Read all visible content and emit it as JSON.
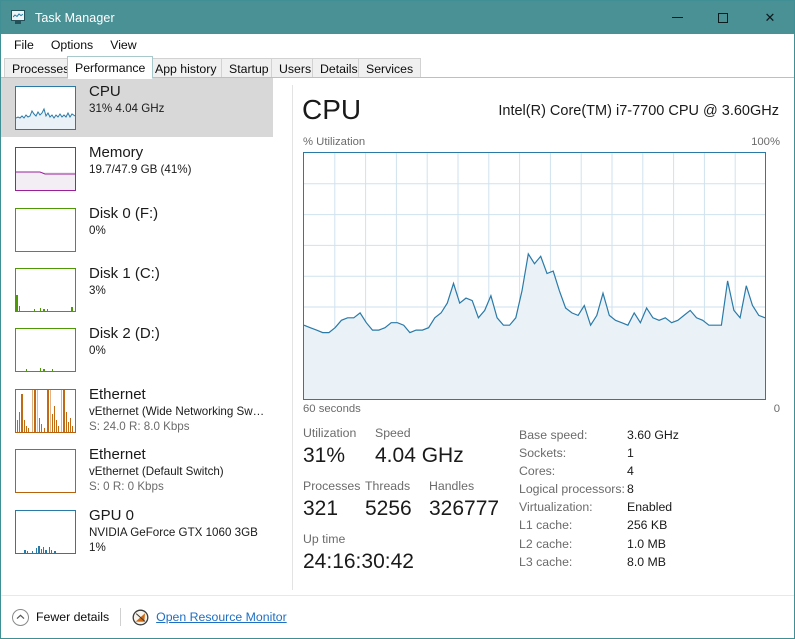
{
  "window": {
    "title": "Task Manager",
    "icon": "task-manager-icon",
    "minimize_label": "Minimize",
    "maximize_label": "Maximize",
    "close_label": "Close",
    "titlebar_color": "#4a9196"
  },
  "menu": [
    "File",
    "Options",
    "View"
  ],
  "tabs": [
    {
      "label": "Processes",
      "active": false
    },
    {
      "label": "Performance",
      "active": true
    },
    {
      "label": "App history",
      "active": false
    },
    {
      "label": "Startup",
      "active": false
    },
    {
      "label": "Users",
      "active": false
    },
    {
      "label": "Details",
      "active": false
    },
    {
      "label": "Services",
      "active": false
    }
  ],
  "sidebar": {
    "items": [
      {
        "name": "CPU",
        "line2": "31%  4.04 GHz",
        "line3": "",
        "selected": true,
        "color": "#2a7aa8",
        "thumb": "line-filled"
      },
      {
        "name": "Memory",
        "line2": "19.7/47.9 GB (41%)",
        "line3": "",
        "selected": false,
        "color": "#9b1f9b",
        "thumb": "memory-fill"
      },
      {
        "name": "Disk 0 (F:)",
        "line2": "0%",
        "line3": "",
        "selected": false,
        "color": "#4e9a06",
        "thumb": "flat"
      },
      {
        "name": "Disk 1 (C:)",
        "line2": "3%",
        "line3": "",
        "selected": false,
        "color": "#4e9a06",
        "thumb": "disk1-spikes"
      },
      {
        "name": "Disk 2 (D:)",
        "line2": "0%",
        "line3": "",
        "selected": false,
        "color": "#4e9a06",
        "thumb": "disk2-spikes"
      },
      {
        "name": "Ethernet",
        "line2": "vEthernet (Wide Networking Sw…",
        "line3": "S: 24.0 R: 8.0 Kbps",
        "selected": false,
        "color": "#b8600c",
        "thumb": "net-spikes"
      },
      {
        "name": "Ethernet",
        "line2": "vEthernet (Default Switch)",
        "line3": "S: 0 R: 0 Kbps",
        "selected": false,
        "color": "#b8600c",
        "thumb": "flat"
      },
      {
        "name": "GPU 0",
        "line2": "NVIDIA GeForce GTX 1060 3GB",
        "line3": "1%",
        "selected": false,
        "color": "#2a7aa8",
        "thumb": "gpu-spikes"
      }
    ]
  },
  "main": {
    "heading": "CPU",
    "model": "Intel(R) Core(TM) i7-7700 CPU @ 3.60GHz",
    "axis_top_left": "% Utilization",
    "axis_top_right": "100%",
    "axis_bottom_left": "60 seconds",
    "axis_bottom_right": "0",
    "stats": {
      "utilization_label": "Utilization",
      "utilization_value": "31%",
      "speed_label": "Speed",
      "speed_value": "4.04 GHz",
      "processes_label": "Processes",
      "processes_value": "321",
      "threads_label": "Threads",
      "threads_value": "5256",
      "handles_label": "Handles",
      "handles_value": "326777",
      "uptime_label": "Up time",
      "uptime_value": "24:16:30:42"
    },
    "specs": [
      {
        "key": "Base speed:",
        "value": "3.60 GHz"
      },
      {
        "key": "Sockets:",
        "value": "1"
      },
      {
        "key": "Cores:",
        "value": "4"
      },
      {
        "key": "Logical processors:",
        "value": "8"
      },
      {
        "key": "Virtualization:",
        "value": "Enabled"
      },
      {
        "key": "L1 cache:",
        "value": "256 KB"
      },
      {
        "key": "L2 cache:",
        "value": "1.0 MB"
      },
      {
        "key": "L3 cache:",
        "value": "8.0 MB"
      }
    ]
  },
  "statusbar": {
    "fewer_details": "Fewer details",
    "fewer_icon": "chevron-up-circle-icon",
    "resource_monitor": "Open Resource Monitor",
    "resource_monitor_icon": "resource-monitor-icon"
  },
  "chart_data": {
    "type": "area",
    "title": "CPU % Utilization",
    "xlabel": "60 seconds",
    "ylabel": "% Utilization",
    "xlim": [
      0,
      60
    ],
    "ylim": [
      0,
      100
    ],
    "grid": true,
    "line_color": "#2a7aa8",
    "fill_color": "#eaf2f8",
    "series": [
      {
        "name": "% Utilization",
        "values": [
          30,
          29,
          28,
          27,
          27,
          29,
          32,
          33,
          33,
          35,
          31,
          28,
          28,
          29,
          31,
          31,
          30,
          27,
          28,
          28,
          29,
          33,
          35,
          39,
          47,
          39,
          41,
          40,
          33,
          36,
          42,
          33,
          30,
          30,
          33,
          44,
          59,
          55,
          58,
          51,
          52,
          44,
          37,
          35,
          34,
          38,
          30,
          34,
          43,
          34,
          32,
          31,
          30,
          35,
          31,
          37,
          33,
          32,
          33,
          31,
          32,
          34,
          36,
          33,
          32,
          30,
          30,
          30,
          48,
          36,
          33,
          46,
          38,
          34,
          33
        ]
      }
    ]
  }
}
